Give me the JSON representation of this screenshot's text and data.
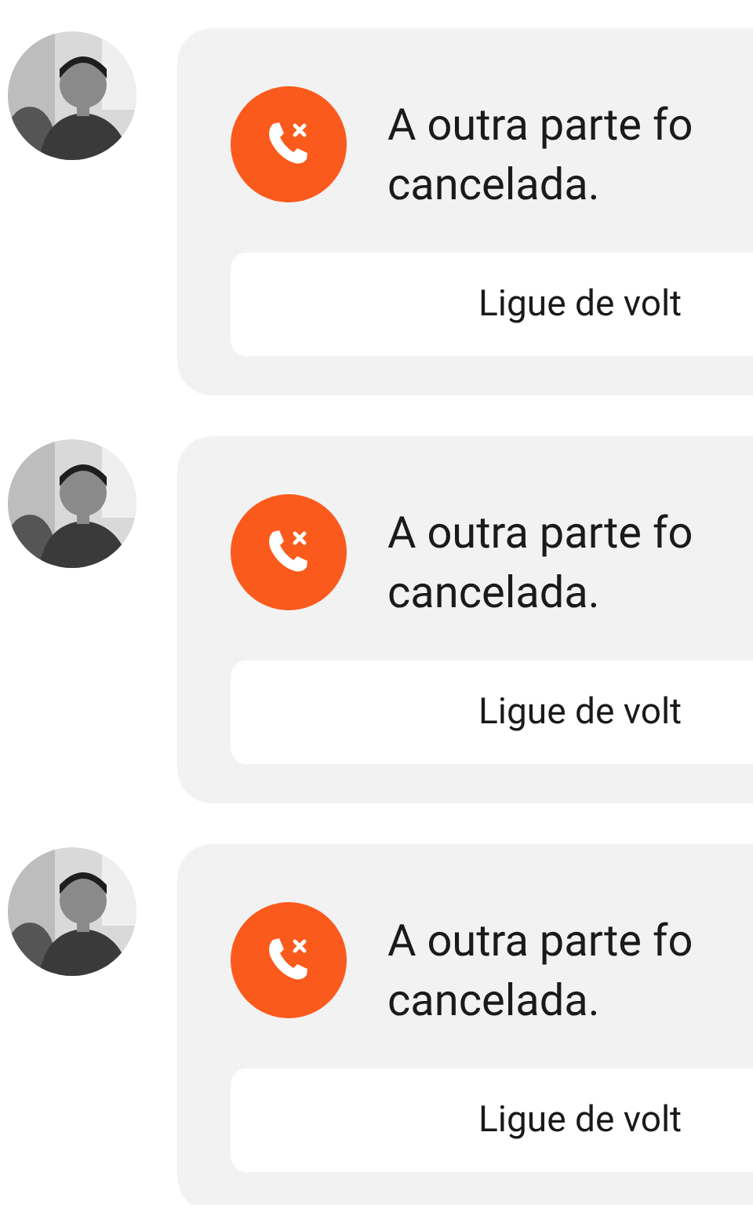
{
  "messages": [
    {
      "kind": "missed_call",
      "text_lines": [
        "A outra parte fo",
        "cancelada."
      ],
      "action": "Ligue de volt"
    },
    {
      "kind": "missed_call",
      "text_lines": [
        "A outra parte fo",
        "cancelada."
      ],
      "action": "Ligue de volt"
    },
    {
      "kind": "missed_call",
      "text_lines": [
        "A outra parte fo",
        "cancelada."
      ],
      "action": "Ligue de volt"
    }
  ]
}
